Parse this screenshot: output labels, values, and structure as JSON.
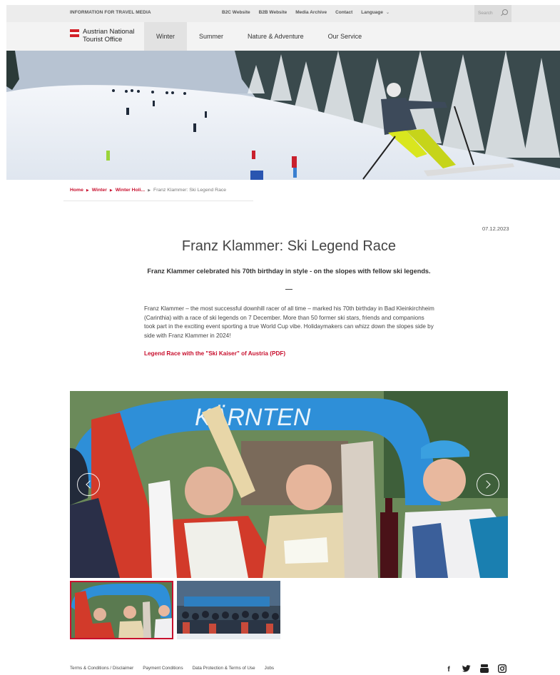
{
  "topbar": {
    "info": "INFORMATION FOR TRAVEL MEDIA",
    "links": [
      "B2C Website",
      "B2B Website",
      "Media Archive",
      "Contact"
    ],
    "language": "Language",
    "search_placeholder": "Search"
  },
  "header": {
    "logo_line1": "Austrian National",
    "logo_line2": "Tourist Office",
    "menu": [
      "Winter",
      "Summer",
      "Nature & Adventure",
      "Our Service"
    ],
    "active_menu": "Winter"
  },
  "breadcrumb": {
    "items": [
      "Home",
      "Winter",
      "Winter Holi..."
    ],
    "current": "Franz Klammer: Ski Legend Race"
  },
  "article": {
    "date": "07.12.2023",
    "title": "Franz Klammer: Ski Legend Race",
    "subtitle": "Franz Klammer celebrated his 70th birthday in style - on the slopes with fellow ski legends.",
    "body": "Franz Klammer – the most successful downhill racer of all time – marked his 70th birthday in Bad Kleinkirchheim (Carinthia) with a race of ski legends on 7 December. More than 50 former ski stars, friends and companions took part in the exciting event sporting a true World Cup vibe. Holidaymakers can whizz down the slopes side by side with Franz Klammer in 2024!",
    "pdf_link": "Legend Race with the \"Ski Kaiser\" of Austria (PDF)"
  },
  "gallery": {
    "banner_text": "KÄRNTEN",
    "active_thumb": 1
  },
  "footer": {
    "links": [
      "Terms & Conditions / Disclaimer",
      "Payment Conditions",
      "Data Protection & Terms of Use",
      "Jobs"
    ],
    "social": [
      "facebook-icon",
      "twitter-icon",
      "youtube-icon",
      "instagram-icon"
    ]
  },
  "colors": {
    "accent": "#c8102e",
    "flag_red": "#d32027",
    "nav_bg": "#f3f3f3",
    "topbar_bg": "#ececec"
  }
}
